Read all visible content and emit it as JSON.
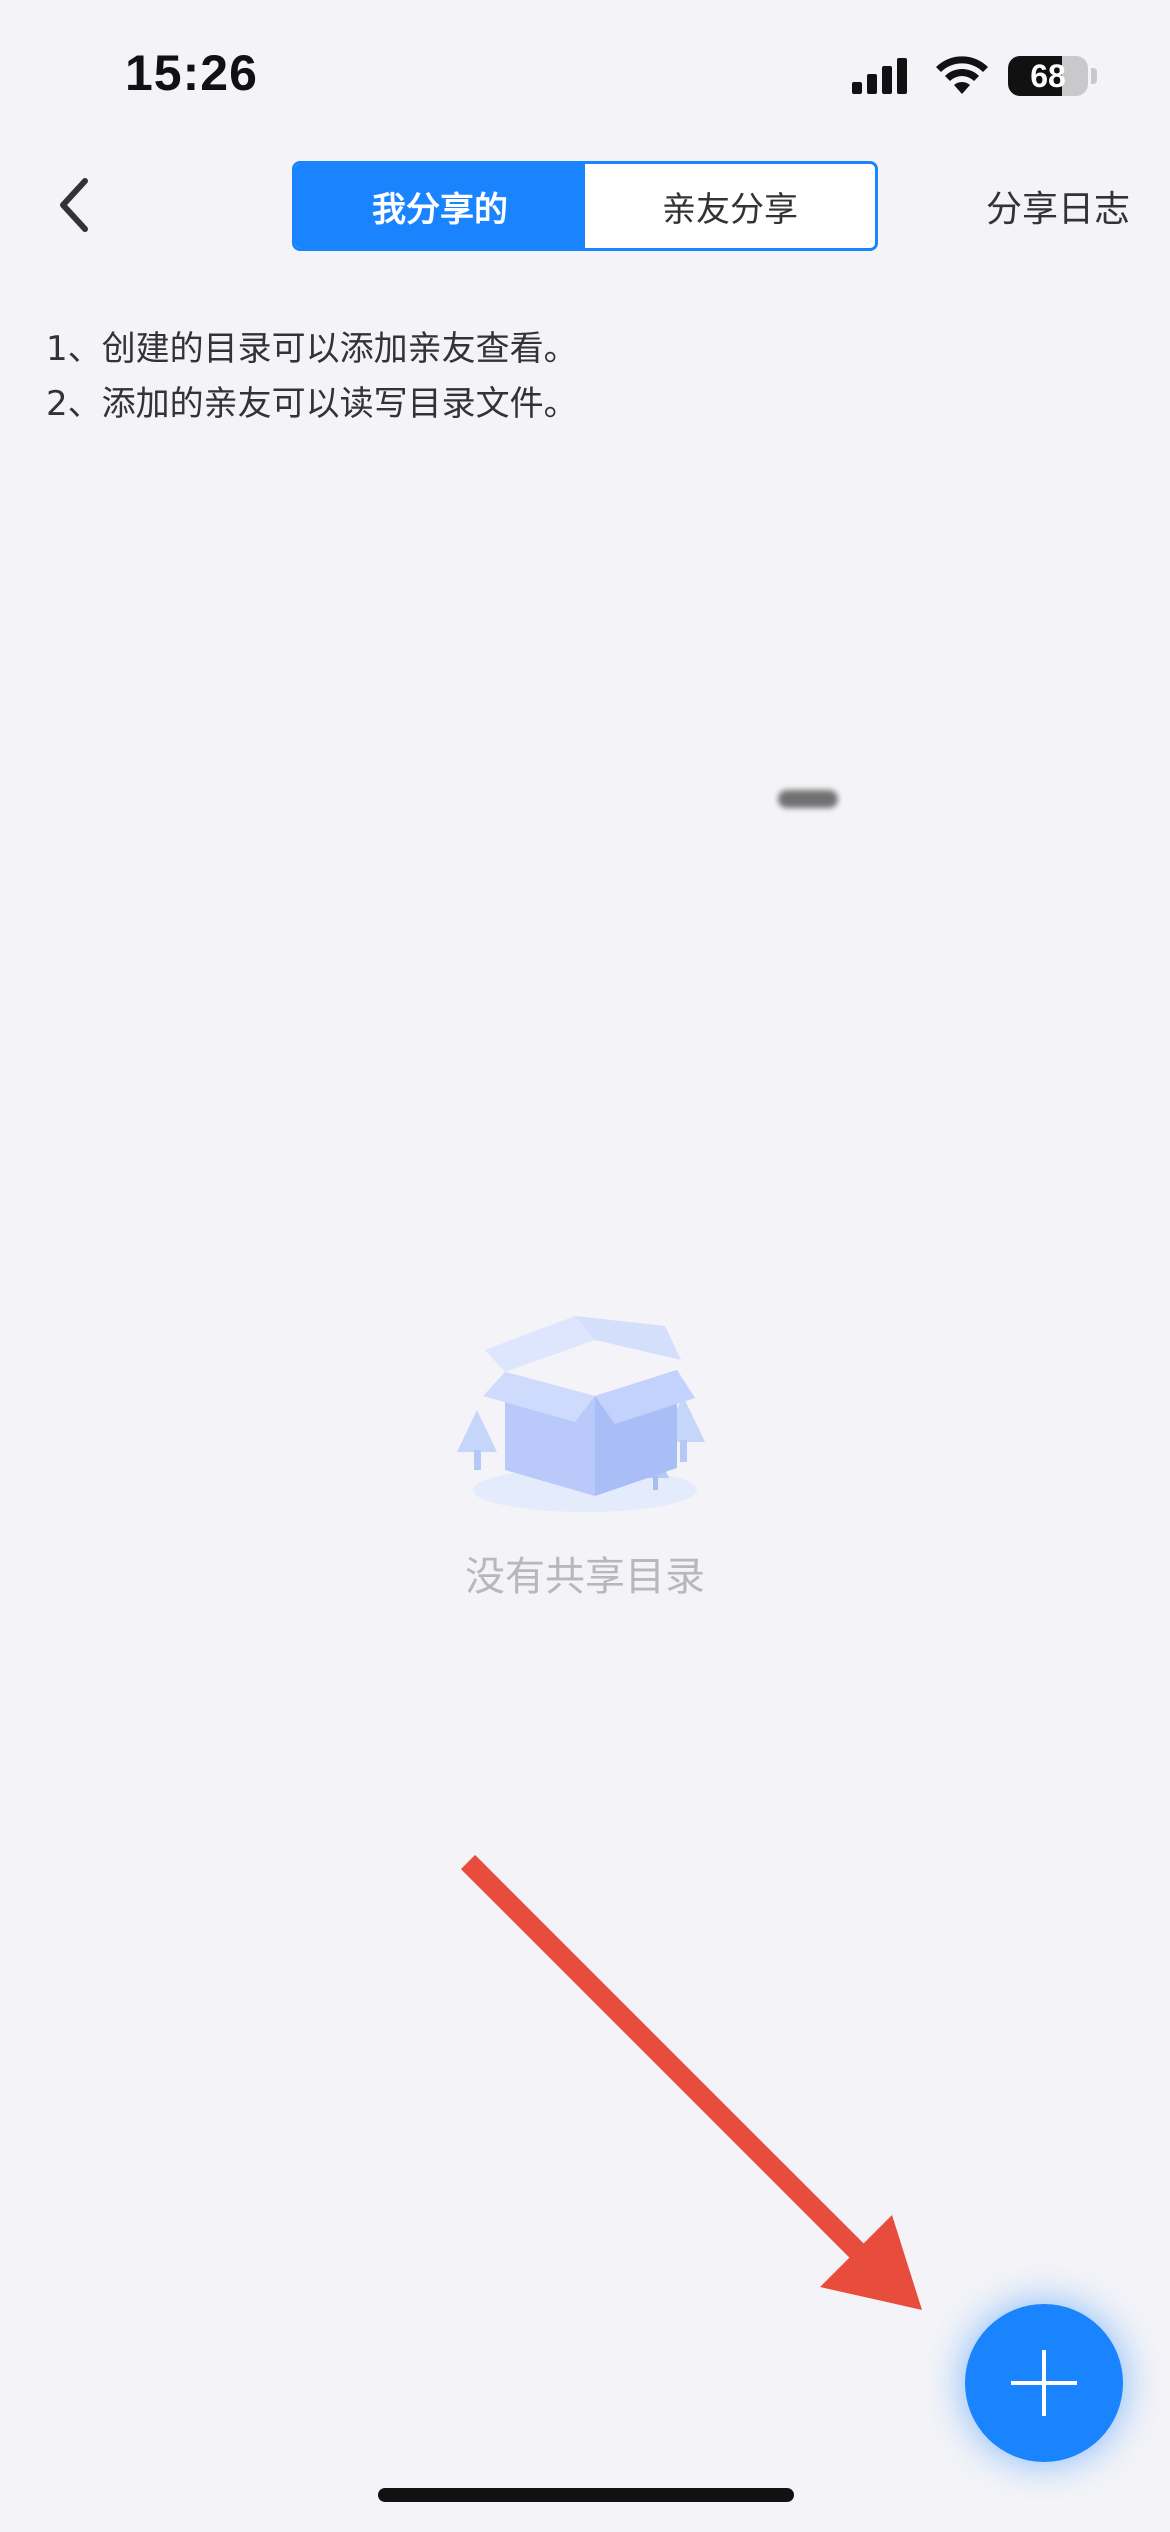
{
  "status_bar": {
    "time": "15:26",
    "battery_level": "68",
    "battery_fraction": 0.68
  },
  "nav": {
    "back_icon": "chevron-left-icon",
    "tabs": [
      {
        "label": "我分享的",
        "active": true
      },
      {
        "label": "亲友分享",
        "active": false
      }
    ],
    "share_log_label": "分享日志"
  },
  "info": {
    "lines": [
      "1、创建的目录可以添加亲友查看。",
      "2、添加的亲友可以读写目录文件。"
    ]
  },
  "empty_state": {
    "icon": "empty-box-icon",
    "message": "没有共享目录"
  },
  "fab": {
    "icon": "plus-icon"
  },
  "colors": {
    "accent": "#1a84ff",
    "annotation_arrow": "#e84c3d",
    "background": "#f4f4f8"
  }
}
